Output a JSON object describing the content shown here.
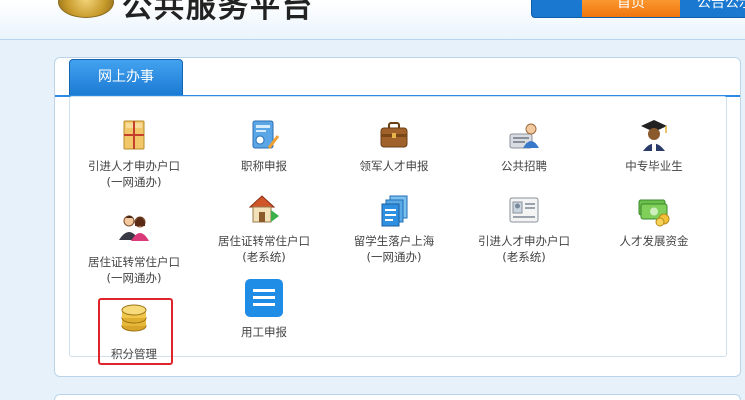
{
  "header": {
    "title": "公共服务平台",
    "nav": {
      "home": "首页",
      "notice": "公告公示"
    }
  },
  "panel": {
    "tab_label": "网上办事",
    "items": [
      {
        "label": "引进人才申办户口",
        "sub": "(一网通办)",
        "icon": "envelope-icon"
      },
      {
        "label": "职称申报",
        "sub": "",
        "icon": "certificate-icon"
      },
      {
        "label": "领军人才申报",
        "sub": "",
        "icon": "briefcase-icon"
      },
      {
        "label": "公共招聘",
        "sub": "",
        "icon": "recruiter-icon"
      },
      {
        "label": "中专毕业生",
        "sub": "",
        "icon": "graduate-icon"
      },
      {
        "label": "居住证转常住户口",
        "sub": "(一网通办)",
        "icon": "people-icon"
      },
      {
        "label": "居住证转常住户口",
        "sub": "(老系统)",
        "icon": "house-icon"
      },
      {
        "label": "留学生落户上海",
        "sub": "(一网通办)",
        "icon": "documents-icon"
      },
      {
        "label": "引进人才申办户口",
        "sub": "(老系统)",
        "icon": "id-card-icon"
      },
      {
        "label": "人才发展资金",
        "sub": "",
        "icon": "money-icon"
      },
      {
        "label": "积分管理",
        "sub": "",
        "icon": "database-icon"
      },
      {
        "label": "用工申报",
        "sub": "",
        "icon": "list-icon"
      }
    ]
  },
  "colors": {
    "accent_blue": "#1c7bd3",
    "nav_orange": "#f0740c",
    "highlight_red": "#e0242b"
  }
}
